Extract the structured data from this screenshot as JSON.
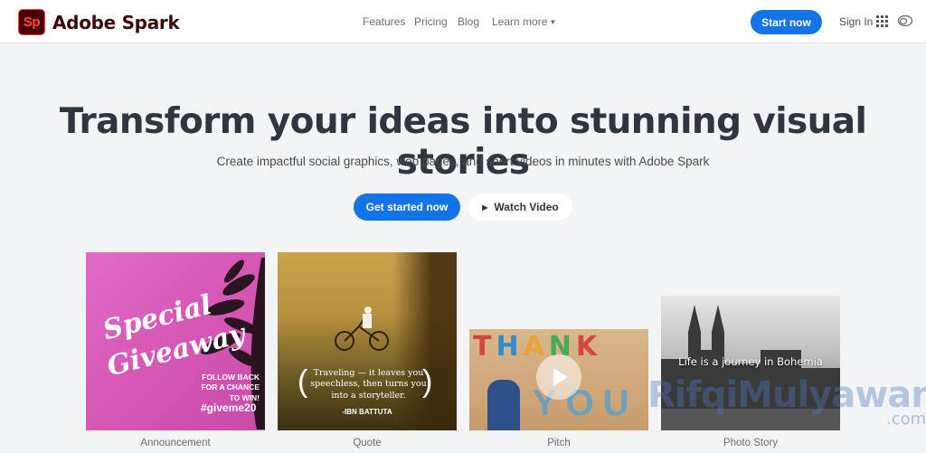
{
  "header": {
    "logo_text": "Sp",
    "brand": "Adobe Spark",
    "nav": [
      "Features",
      "Pricing",
      "Blog",
      "Learn more"
    ],
    "start_button": "Start now",
    "signin": "Sign In",
    "icons": [
      "apps-grid-icon",
      "creative-cloud-icon"
    ]
  },
  "hero": {
    "headline": "Transform your ideas into stunning visual stories",
    "subhead": "Create impactful social graphics, web pages, and short videos in minutes with Adobe Spark",
    "primary_cta": "Get started now",
    "secondary_cta": "Watch Video"
  },
  "cards": [
    {
      "caption": "Announcement",
      "title_line1": "Special",
      "title_line2": "Giveaway",
      "follow_text": "FOLLOW BACK FOR A CHANCE TO WIN!",
      "hashtag": "#giveme20"
    },
    {
      "caption": "Quote",
      "quote": "Traveling — it leaves you speechless, then turns you into a storyteller.",
      "author": "-IBN BATTUTA"
    },
    {
      "caption": "Pitch",
      "word_top": "THANK",
      "word_bottom": "YOU"
    },
    {
      "caption": "Photo Story",
      "overlay_text": "Life is a journey in Bohemia"
    }
  ],
  "watermark": {
    "name": "RifqiMulyawan",
    "suffix": ".com"
  },
  "colors": {
    "primary": "#1473e6",
    "background": "#f3f4f6",
    "logo_bg": "#4b0000",
    "logo_red": "#ff4a3c"
  }
}
